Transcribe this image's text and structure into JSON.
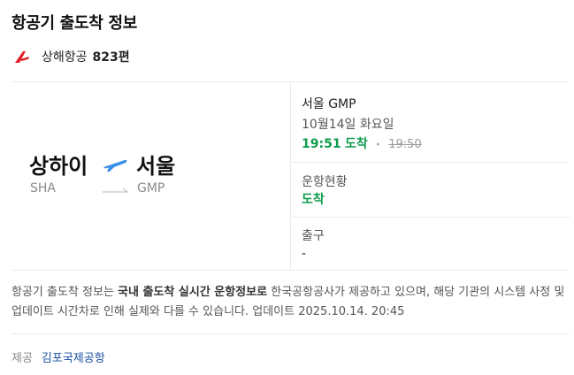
{
  "page": {
    "title": "항공기 출도착 정보"
  },
  "airline": {
    "name": "상해항공",
    "flight_no": "823편",
    "brand_color": "#e0202a",
    "logo_icon": "airline-logo-icon"
  },
  "route": {
    "origin_city": "상하이",
    "origin_code": "SHA",
    "dest_city": "서울",
    "dest_code": "GMP",
    "plane_icon": "plane-icon",
    "arrow_icon": "arrow-right-icon"
  },
  "arrival": {
    "airport": "서울 GMP",
    "date": "10월14일 화요일",
    "actual_time": "19:51",
    "status_label": "도착",
    "scheduled_time": "19:50"
  },
  "flight_status": {
    "label": "운항현황",
    "value": "도착"
  },
  "exit": {
    "label": "출구",
    "value": "-"
  },
  "notice": {
    "prefix": "항공기 출도착 정보는 ",
    "bold": "국내 출도착 실시간 운항정보로",
    "suffix": " 한국공항공사가 제공하고 있으며, 해당 기관의 시스템 사정 및 업데이트 시간차로 인해 실제와 다를 수 있습니다. 업데이트 2025.10.14. 20:45"
  },
  "provider": {
    "label": "제공",
    "name": "김포국제공항"
  },
  "colors": {
    "accent_green": "#0c9c4c",
    "plane_blue": "#3a8ee6",
    "link_blue": "#1a4fa0"
  }
}
